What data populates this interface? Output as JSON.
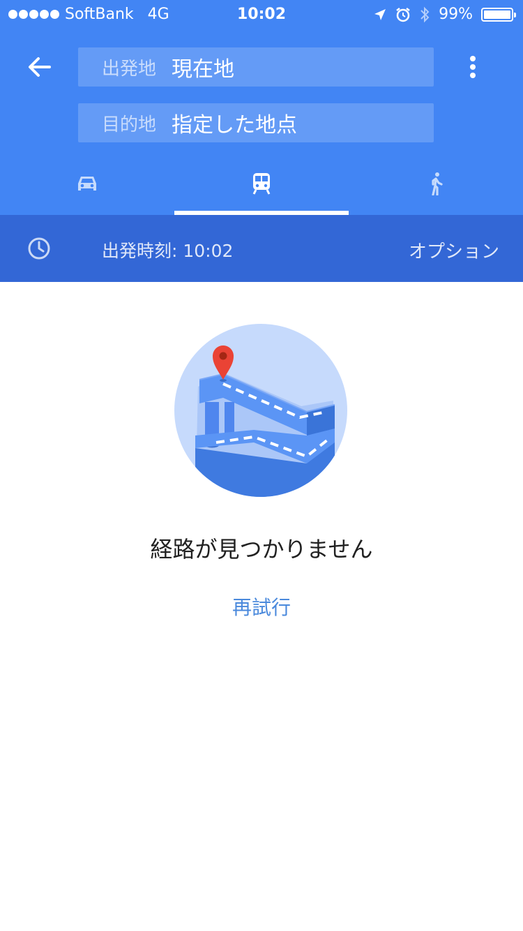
{
  "status_bar": {
    "carrier": "SoftBank",
    "network": "4G",
    "time": "10:02",
    "battery": "99%",
    "battery_level": 0.99,
    "icons": [
      "location-arrow-icon",
      "alarm-icon",
      "bluetooth-icon"
    ]
  },
  "route": {
    "origin_label": "出発地",
    "origin_value": "現在地",
    "destination_label": "目的地",
    "destination_value": "指定した地点"
  },
  "tabs": [
    {
      "name": "car",
      "icon": "car-icon",
      "active": false
    },
    {
      "name": "transit",
      "icon": "train-icon",
      "active": true
    },
    {
      "name": "walk",
      "icon": "walk-icon",
      "active": false
    }
  ],
  "time_bar": {
    "depart_text": "出発時刻: 10:02",
    "options_label": "オプション"
  },
  "result": {
    "message": "経路が見つかりません",
    "retry_label": "再試行"
  },
  "colors": {
    "primary": "#4285f4",
    "primary_dark": "#3367d6",
    "link": "#4a89dc",
    "pin": "#ea4335"
  }
}
